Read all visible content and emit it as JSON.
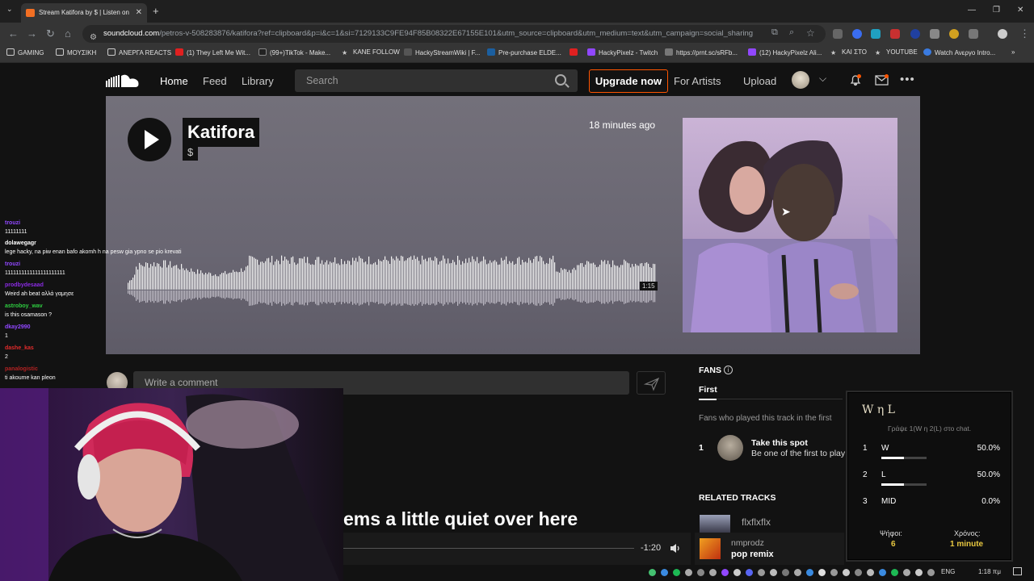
{
  "browser": {
    "tab_title": "Stream Katifora by $ | Listen on",
    "url_host": "soundcloud.com",
    "url_path": "/petros-v-508283876/katifora?ref=clipboard&p=i&c=1&si=7129133C9FE94F85B08322E67155E101&utm_source=clipboard&utm_medium=text&utm_campaign=social_sharing",
    "bookmarks": [
      "GAMING",
      "ΜΟΥΣΙΚΗ",
      "ΑΝΕΡΓΑ REACTS",
      "(1) They Left Me Wit...",
      "(99+)TikTok - Make...",
      "KANE FOLLOW",
      "HackyStreamWiki | F...",
      "Pre-purchase ELDE...",
      "HackyPixelz - Twitch",
      "https://prnt.sc/sRFb...",
      "(12) HackyPixelz Ali...",
      "ΚΑΙ ΣΤΟ",
      "YOUTUBE",
      "Watch Ανεργο Intro..."
    ]
  },
  "nav": {
    "home": "Home",
    "feed": "Feed",
    "library": "Library",
    "search_placeholder": "Search",
    "upgrade": "Upgrade now",
    "for_artists": "For Artists",
    "upload": "Upload"
  },
  "track": {
    "title": "Katifora",
    "artist": "$",
    "posted": "18 minutes ago",
    "duration": "1:15"
  },
  "chat": [
    {
      "user": "trouzi",
      "msg": "11111111",
      "color": "#9147ff"
    },
    {
      "user": "dolawegagr",
      "msg": "lege hacky, na piw enan bafo akomh h na pesw gia ypno se pio krevati",
      "color": "#ffffff"
    },
    {
      "user": "trouzi",
      "msg": "1111111111111111111111",
      "color": "#9147ff"
    },
    {
      "user": "prodbydesaad",
      "msg": "Weird ah beat αλλά γαμησε",
      "color": "#8a2be2"
    },
    {
      "user": "astroboy_wav",
      "msg": "is this osamason ?",
      "color": "#2ecc40"
    },
    {
      "user": "dkay2990",
      "msg": "1",
      "color": "#9147ff"
    },
    {
      "user": "dashe_kas",
      "msg": "2",
      "color": "#e22b2b"
    },
    {
      "user": "panalogistic",
      "msg": "ti akoume kan pleon",
      "color": "#b22222"
    }
  ],
  "comment": {
    "placeholder": "Write a comment"
  },
  "empty_text": "ems a little quiet over here",
  "player": {
    "remaining": "-1:20"
  },
  "fans": {
    "heading": "FANS",
    "tab_first": "First",
    "subtitle": "Fans who played this track in the first",
    "rank": "1",
    "spot_title": "Take this spot",
    "spot_sub": "Be one of the first to play"
  },
  "related": {
    "heading": "RELATED TRACKS",
    "tracks": [
      {
        "artist": "",
        "title": "flxflxflx"
      },
      {
        "artist": "nmprodz",
        "title": "pop remix"
      }
    ]
  },
  "poll": {
    "title": "W η L",
    "instruction": "Γράψε 1(W η 2(L) στο chat.",
    "options": [
      {
        "num": "1",
        "label": "W",
        "pct": "50.0%",
        "fill": 0.5
      },
      {
        "num": "2",
        "label": "L",
        "pct": "50.0%",
        "fill": 0.5
      },
      {
        "num": "3",
        "label": "MID",
        "pct": "0.0%",
        "fill": 0
      }
    ],
    "votes_label": "Ψήφοι:",
    "votes": "6",
    "time_label": "Χρόνος:",
    "time": "1 minute"
  },
  "taskbar": {
    "lang": "ENG",
    "clock": "1:18 πμ"
  },
  "colors": {
    "accent": "#ff5500",
    "background": "#121212"
  }
}
